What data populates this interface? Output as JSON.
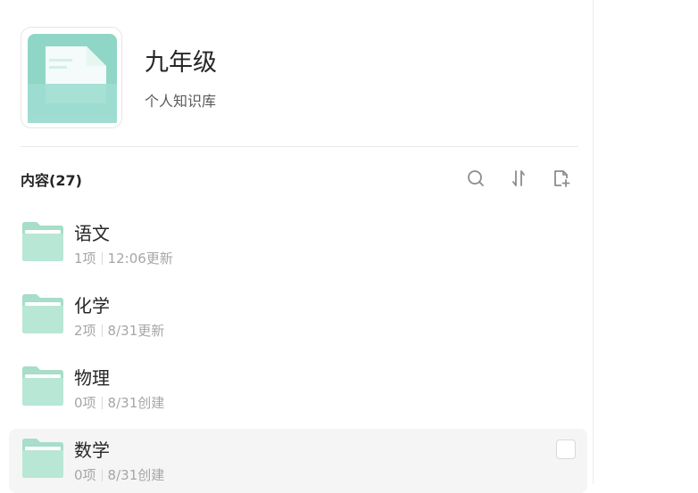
{
  "library": {
    "title": "九年级",
    "subtitle": "个人知识库",
    "icon": "library-cover-icon"
  },
  "content": {
    "header": "内容(27)",
    "tools": [
      "search-icon",
      "sort-icon",
      "new-document-icon"
    ]
  },
  "items": [
    {
      "name": "语文",
      "count": "1项",
      "time": "12:06更新"
    },
    {
      "name": "化学",
      "count": "2项",
      "time": "8/31更新"
    },
    {
      "name": "物理",
      "count": "0项",
      "time": "8/31创建"
    },
    {
      "name": "数学",
      "count": "0项",
      "time": "8/31创建"
    }
  ],
  "colors": {
    "accent": "#8fd6c6",
    "folder": "#b4e6d3",
    "hover": "#f5f5f5"
  }
}
